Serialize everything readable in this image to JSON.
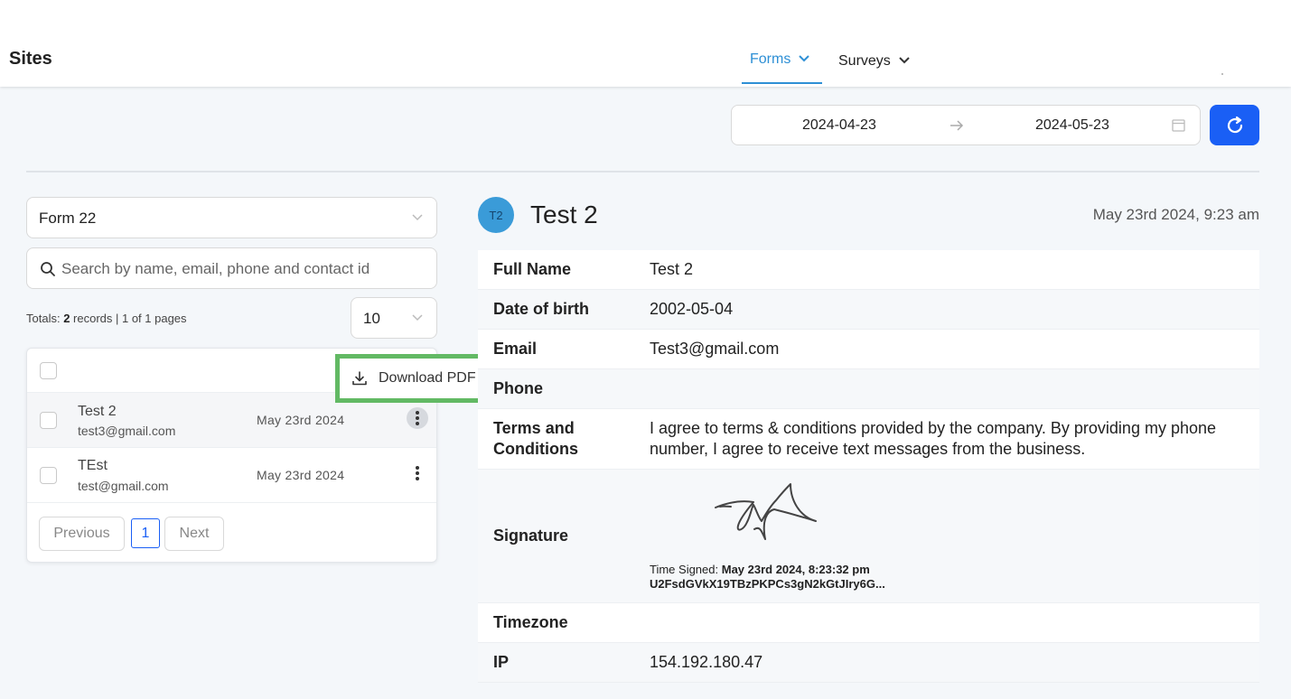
{
  "app": {
    "title": "Sites"
  },
  "nav": {
    "tabs": [
      {
        "label": "Forms",
        "active": true
      },
      {
        "label": "Surveys",
        "active": false
      }
    ]
  },
  "date_range": {
    "start": "2024-04-23",
    "end": "2024-05-23"
  },
  "filters": {
    "form_select": "Form 22",
    "search_placeholder": "Search by name, email, phone and contact id",
    "page_size": "10"
  },
  "totals": {
    "prefix": "Totals: ",
    "count": "2",
    "suffix": " records | 1 of 1 pages"
  },
  "records": [
    {
      "name": "Test 2",
      "email": "test3@gmail.com",
      "date": "May 23rd 2024",
      "selected": true
    },
    {
      "name": "TEst",
      "email": "test@gmail.com",
      "date": "May 23rd 2024",
      "selected": false
    }
  ],
  "pagination": {
    "previous": "Previous",
    "current": "1",
    "next": "Next"
  },
  "popup": {
    "label": "Download PDF"
  },
  "detail": {
    "avatar": "T2",
    "title": "Test 2",
    "timestamp": "May 23rd 2024, 9:23 am",
    "fields": {
      "full_name": {
        "label": "Full Name",
        "value": "Test 2"
      },
      "dob": {
        "label": "Date of birth",
        "value": "2002-05-04"
      },
      "email": {
        "label": "Email",
        "value": "Test3@gmail.com"
      },
      "phone": {
        "label": "Phone",
        "value": ""
      },
      "terms": {
        "label": "Terms and Conditions",
        "value": "I agree to terms & conditions provided by the company. By providing my phone number, I agree to receive text messages from the business."
      },
      "signature": {
        "label": "Signature",
        "time_signed_label": "Time Signed: ",
        "time_signed": "May 23rd 2024, 8:23:32 pm",
        "hash": "U2FsdGVkX19TBzPKPCs3gN2kGtJIry6G..."
      },
      "timezone": {
        "label": "Timezone",
        "value": ""
      },
      "ip": {
        "label": "IP",
        "value": "154.192.180.47"
      }
    }
  },
  "colors": {
    "accent": "#2d8fd5",
    "primary_button": "#1a5ff5",
    "highlight_border": "#62b964",
    "avatar": "#3a9bd8"
  },
  "icons": {
    "tab_chevron": "chevron-down-icon",
    "arrow": "arrow-right-icon",
    "calendar": "calendar-icon",
    "refresh": "refresh-icon",
    "search": "search-icon",
    "kebab": "more-vertical-icon",
    "download": "download-icon"
  }
}
